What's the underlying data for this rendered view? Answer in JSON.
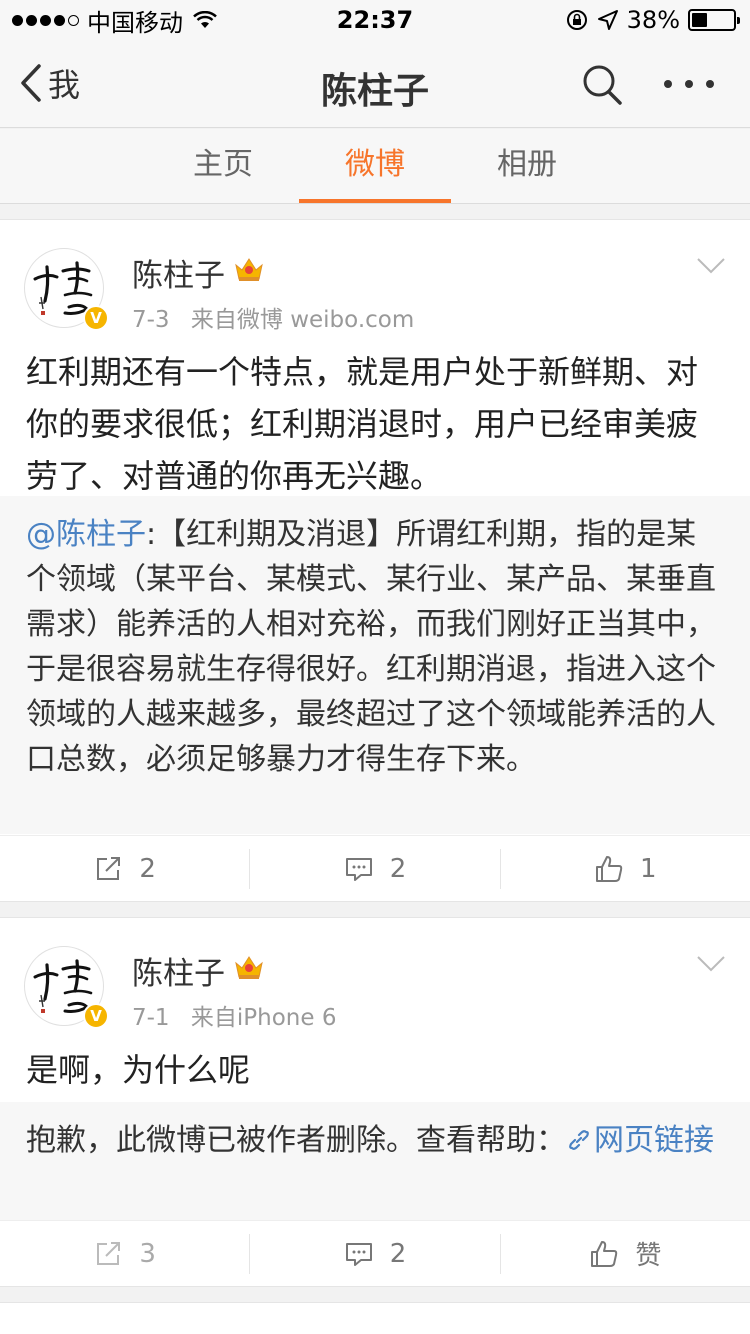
{
  "status_bar": {
    "carrier": "中国移动",
    "time": "22:37",
    "battery": "38%",
    "battery_level": 0.38
  },
  "nav": {
    "back_label": "我",
    "title": "陈柱子"
  },
  "tabs": [
    {
      "label": "主页"
    },
    {
      "label": "微博"
    },
    {
      "label": "相册"
    }
  ],
  "posts": [
    {
      "user": "陈柱子",
      "date": "7-3",
      "source": "来自微博 weibo.com",
      "text": "红利期还有一个特点，就是用户处于新鲜期、对你的要求很低；红利期消退时，用户已经审美疲劳了、对普通的你再无兴趣。",
      "repost_mention": "@陈柱子",
      "repost_text": ":【红利期及消退】所谓红利期，指的是某个领域（某平台、某模式、某行业、某产品、某垂直需求）能养活的人相对充裕，而我们刚好正当其中，于是很容易就生存得很好。红利期消退，指进入这个领域的人越来越多，最终超过了这个领域能养活的人口总数，必须足够暴力才得生存下来。",
      "reposts": "2",
      "comments": "2",
      "likes": "1"
    },
    {
      "user": "陈柱子",
      "date": "7-1",
      "source": "来自iPhone 6",
      "text": "是啊，为什么呢",
      "deleted_text": "抱歉，此微博已被作者删除。查看帮助：",
      "link_text": "网页链接",
      "reposts": "3",
      "comments": "2",
      "likes": "赞"
    }
  ],
  "colors": {
    "accent": "#f7752b",
    "link": "#4a82c3",
    "verified": "#f6b500"
  }
}
